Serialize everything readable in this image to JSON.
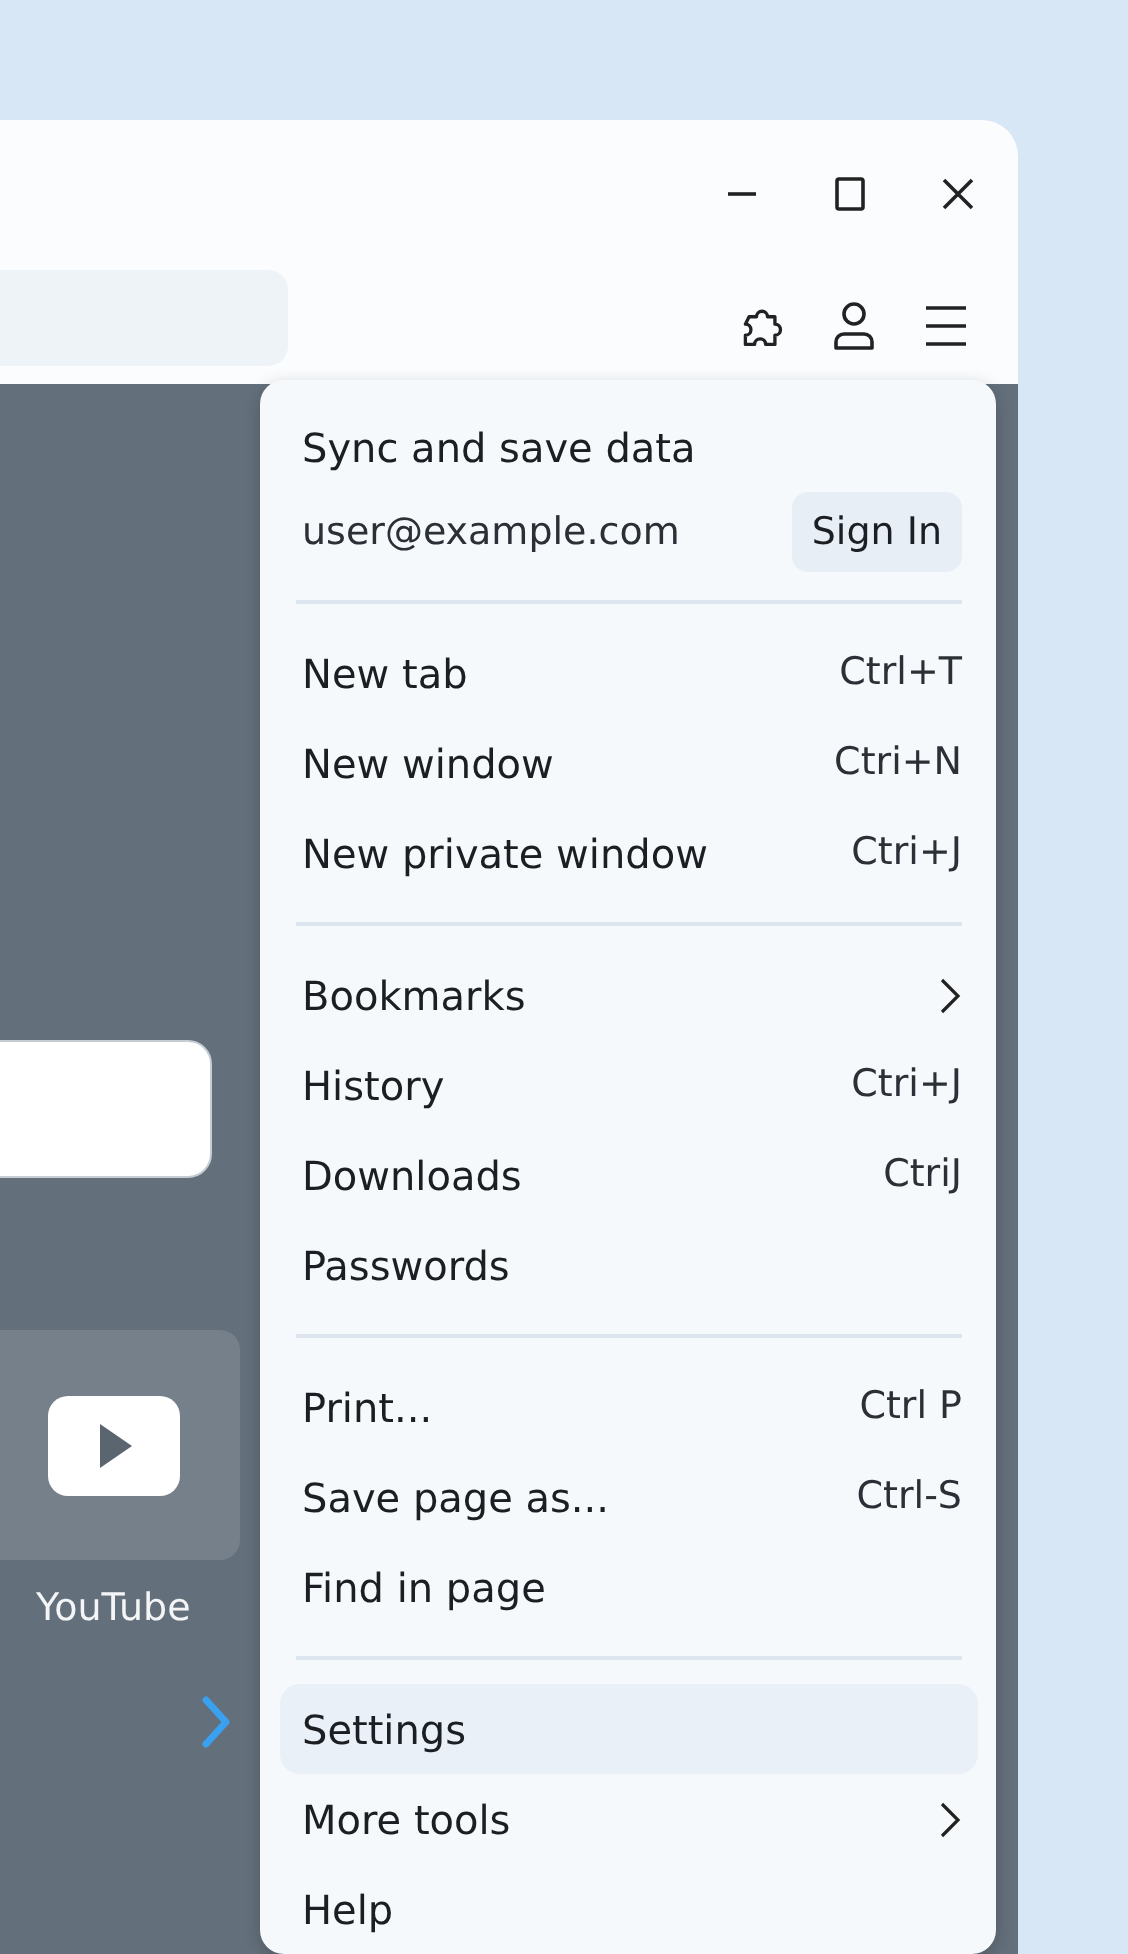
{
  "new_tab_page": {
    "shortcut": {
      "label": "YouTube"
    }
  },
  "menu": {
    "account": {
      "title": "Sync and save data",
      "email": "user@example.com",
      "sign_in": "Sign In"
    },
    "sections": [
      [
        {
          "label": "New tab",
          "shortcut": "Ctrl+T",
          "has_submenu": false,
          "selected": false
        },
        {
          "label": "New window",
          "shortcut": "Ctri+N",
          "has_submenu": false,
          "selected": false
        },
        {
          "label": "New private window",
          "shortcut": "Ctri+J",
          "has_submenu": false,
          "selected": false
        }
      ],
      [
        {
          "label": "Bookmarks",
          "has_submenu": true,
          "selected": false
        },
        {
          "label": "History",
          "shortcut": "Ctri+J",
          "has_submenu": false,
          "selected": false
        },
        {
          "label": "Downloads",
          "shortcut": "CtriJ",
          "has_submenu": false,
          "selected": false
        },
        {
          "label": "Passwords",
          "has_submenu": false,
          "selected": false
        }
      ],
      [
        {
          "label": "Print...",
          "shortcut": "Ctrl P",
          "has_submenu": false,
          "selected": false
        },
        {
          "label": "Save page as...",
          "shortcut": "Ctrl-S",
          "has_submenu": false,
          "selected": false
        },
        {
          "label": "Find in page",
          "has_submenu": false,
          "selected": false
        }
      ],
      [
        {
          "label": "Settings",
          "has_submenu": false,
          "selected": true
        },
        {
          "label": "More tools",
          "has_submenu": true,
          "selected": false
        },
        {
          "label": "Help",
          "has_submenu": false,
          "selected": false
        }
      ]
    ]
  }
}
